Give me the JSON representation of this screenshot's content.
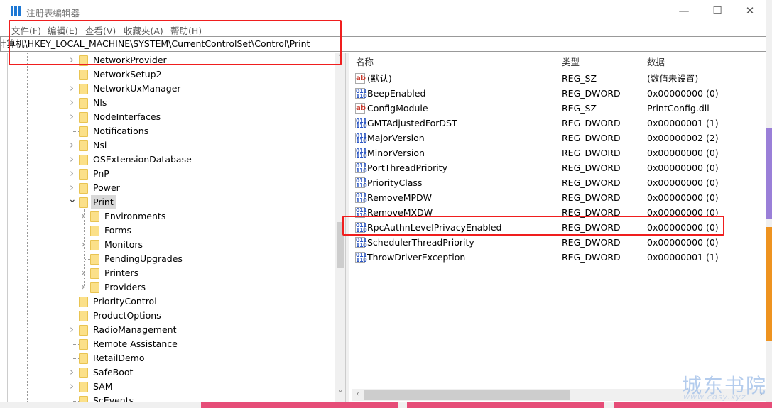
{
  "window": {
    "title": "注册表编辑器",
    "minimize": "—",
    "maximize": "☐",
    "close": "✕"
  },
  "menu": [
    {
      "label": "文件(F)"
    },
    {
      "label": "编辑(E)"
    },
    {
      "label": "查看(V)"
    },
    {
      "label": "收藏夹(A)"
    },
    {
      "label": "帮助(H)"
    }
  ],
  "address": "计算机\\HKEY_LOCAL_MACHINE\\SYSTEM\\CurrentControlSet\\Control\\Print",
  "tree": [
    {
      "label": "NetworkProvider",
      "level": 0,
      "state": "collapsed"
    },
    {
      "label": "NetworkSetup2",
      "level": 0,
      "state": "leaf"
    },
    {
      "label": "NetworkUxManager",
      "level": 0,
      "state": "collapsed"
    },
    {
      "label": "Nls",
      "level": 0,
      "state": "collapsed"
    },
    {
      "label": "NodeInterfaces",
      "level": 0,
      "state": "collapsed"
    },
    {
      "label": "Notifications",
      "level": 0,
      "state": "leaf"
    },
    {
      "label": "Nsi",
      "level": 0,
      "state": "collapsed"
    },
    {
      "label": "OSExtensionDatabase",
      "level": 0,
      "state": "collapsed"
    },
    {
      "label": "PnP",
      "level": 0,
      "state": "collapsed"
    },
    {
      "label": "Power",
      "level": 0,
      "state": "collapsed"
    },
    {
      "label": "Print",
      "level": 0,
      "state": "expanded",
      "selected": true
    },
    {
      "label": "Environments",
      "level": 1,
      "state": "collapsed"
    },
    {
      "label": "Forms",
      "level": 1,
      "state": "leaf"
    },
    {
      "label": "Monitors",
      "level": 1,
      "state": "collapsed"
    },
    {
      "label": "PendingUpgrades",
      "level": 1,
      "state": "leaf"
    },
    {
      "label": "Printers",
      "level": 1,
      "state": "collapsed"
    },
    {
      "label": "Providers",
      "level": 1,
      "state": "collapsed"
    },
    {
      "label": "PriorityControl",
      "level": 0,
      "state": "leaf"
    },
    {
      "label": "ProductOptions",
      "level": 0,
      "state": "leaf"
    },
    {
      "label": "RadioManagement",
      "level": 0,
      "state": "collapsed"
    },
    {
      "label": "Remote Assistance",
      "level": 0,
      "state": "leaf"
    },
    {
      "label": "RetailDemo",
      "level": 0,
      "state": "leaf"
    },
    {
      "label": "SafeBoot",
      "level": 0,
      "state": "collapsed"
    },
    {
      "label": "SAM",
      "level": 0,
      "state": "collapsed"
    },
    {
      "label": "ScEvents",
      "level": 0,
      "state": "leaf"
    }
  ],
  "list": {
    "columns": {
      "name": "名称",
      "type": "类型",
      "data": "数据"
    },
    "rows": [
      {
        "icon": "string-value-icon",
        "name": "(默认)",
        "type": "REG_SZ",
        "data": "(数值未设置)"
      },
      {
        "icon": "binary-value-icon",
        "name": "BeepEnabled",
        "type": "REG_DWORD",
        "data": "0x00000000 (0)"
      },
      {
        "icon": "string-value-icon",
        "name": "ConfigModule",
        "type": "REG_SZ",
        "data": "PrintConfig.dll"
      },
      {
        "icon": "binary-value-icon",
        "name": "GMTAdjustedForDST",
        "type": "REG_DWORD",
        "data": "0x00000001 (1)"
      },
      {
        "icon": "binary-value-icon",
        "name": "MajorVersion",
        "type": "REG_DWORD",
        "data": "0x00000002 (2)"
      },
      {
        "icon": "binary-value-icon",
        "name": "MinorVersion",
        "type": "REG_DWORD",
        "data": "0x00000000 (0)"
      },
      {
        "icon": "binary-value-icon",
        "name": "PortThreadPriority",
        "type": "REG_DWORD",
        "data": "0x00000000 (0)"
      },
      {
        "icon": "binary-value-icon",
        "name": "PriorityClass",
        "type": "REG_DWORD",
        "data": "0x00000000 (0)"
      },
      {
        "icon": "binary-value-icon",
        "name": "RemoveMPDW",
        "type": "REG_DWORD",
        "data": "0x00000000 (0)"
      },
      {
        "icon": "binary-value-icon",
        "name": "RemoveMXDW",
        "type": "REG_DWORD",
        "data": "0x00000000 (0)"
      },
      {
        "icon": "binary-value-icon",
        "name": "RpcAuthnLevelPrivacyEnabled",
        "type": "REG_DWORD",
        "data": "0x00000000 (0)",
        "highlighted": true
      },
      {
        "icon": "binary-value-icon",
        "name": "SchedulerThreadPriority",
        "type": "REG_DWORD",
        "data": "0x00000000 (0)"
      },
      {
        "icon": "binary-value-icon",
        "name": "ThrowDriverException",
        "type": "REG_DWORD",
        "data": "0x00000001 (1)"
      }
    ]
  },
  "watermark": {
    "text": "城东书院",
    "url": "www.cdsy.xyz"
  },
  "colors": {
    "annotation": "#f01e1e",
    "folder": "#fbe089",
    "selection": "#d9d9d9"
  }
}
